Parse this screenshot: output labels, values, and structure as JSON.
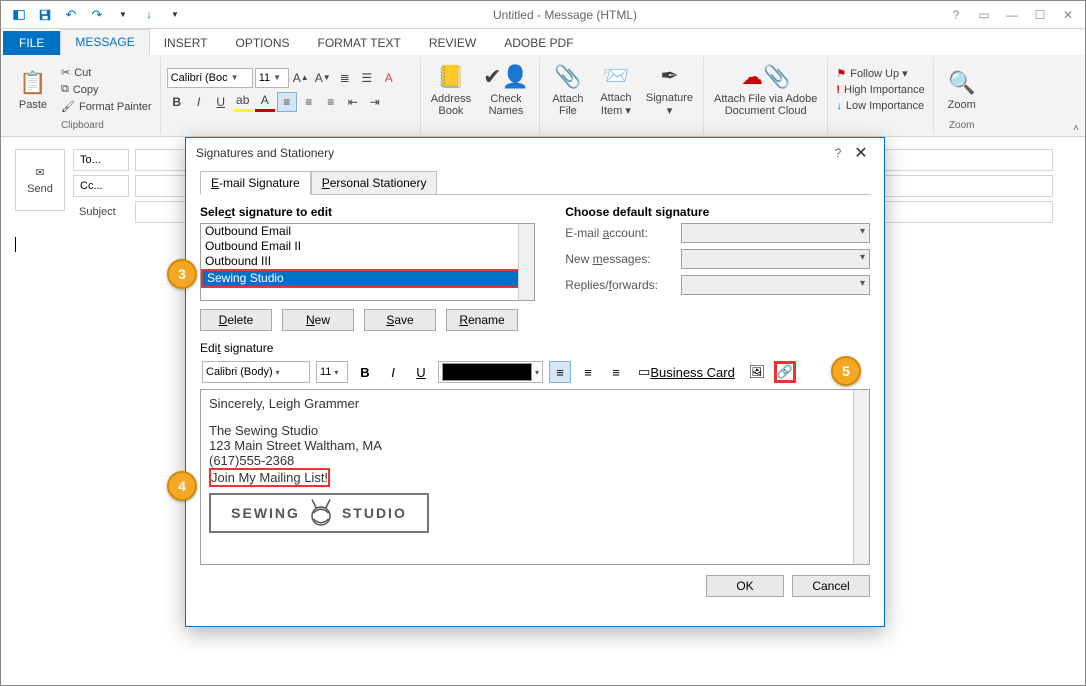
{
  "window": {
    "title": "Untitled - Message (HTML)"
  },
  "tabs": {
    "file": "FILE",
    "message": "MESSAGE",
    "insert": "INSERT",
    "options": "OPTIONS",
    "format_text": "FORMAT TEXT",
    "review": "REVIEW",
    "adobe_pdf": "ADOBE PDF"
  },
  "clipboard": {
    "paste": "Paste",
    "cut": "Cut",
    "copy": "Copy",
    "format_painter": "Format Painter",
    "group": "Clipboard"
  },
  "font": {
    "name": "Calibri (Boc",
    "size": "11"
  },
  "names_group": {
    "address_book": "Address\nBook",
    "check_names": "Check\nNames"
  },
  "include_group": {
    "attach_file": "Attach\nFile",
    "attach_item": "Attach\nItem ▾",
    "signature": "Signature\n▾"
  },
  "adobe_group": {
    "label": "Attach File via Adobe\nDocument Cloud"
  },
  "tags_group": {
    "follow_up": "Follow Up ▾",
    "high": "High Importance",
    "low": "Low Importance"
  },
  "zoom_group": {
    "zoom": "Zoom",
    "label": "Zoom"
  },
  "compose": {
    "send": "Send",
    "to": "To...",
    "cc": "Cc...",
    "subject": "Subject"
  },
  "dialog": {
    "title": "Signatures and Stationery",
    "tab_email": "E-mail Signature",
    "tab_personal": "Personal Stationery",
    "select_label": "Select signature to edit",
    "signatures": [
      "Outbound Email",
      "Outbound Email II",
      "Outbound III",
      "Sewing Studio"
    ],
    "selected_index": 3,
    "btn_delete": "Delete",
    "btn_new": "New",
    "btn_save": "Save",
    "btn_rename": "Rename",
    "choose_label": "Choose default signature",
    "acct_label": "E-mail account:",
    "newmsg_label": "New messages:",
    "replies_label": "Replies/forwards:",
    "edit_label": "Edit signature",
    "font_name": "Calibri (Body)",
    "font_size": "11",
    "biz_card": "Business Card",
    "content": {
      "line1": "Sincerely,   Leigh Grammer",
      "line2": "The Sewing Studio",
      "line3": "123 Main Street Waltham, MA",
      "line4": "(617)555-2368",
      "join": "Join My Mailing List!",
      "logo_left": "SEWING",
      "logo_right": "STUDIO"
    },
    "ok": "OK",
    "cancel": "Cancel"
  },
  "annotations": {
    "three": "3",
    "four": "4",
    "five": "5"
  }
}
